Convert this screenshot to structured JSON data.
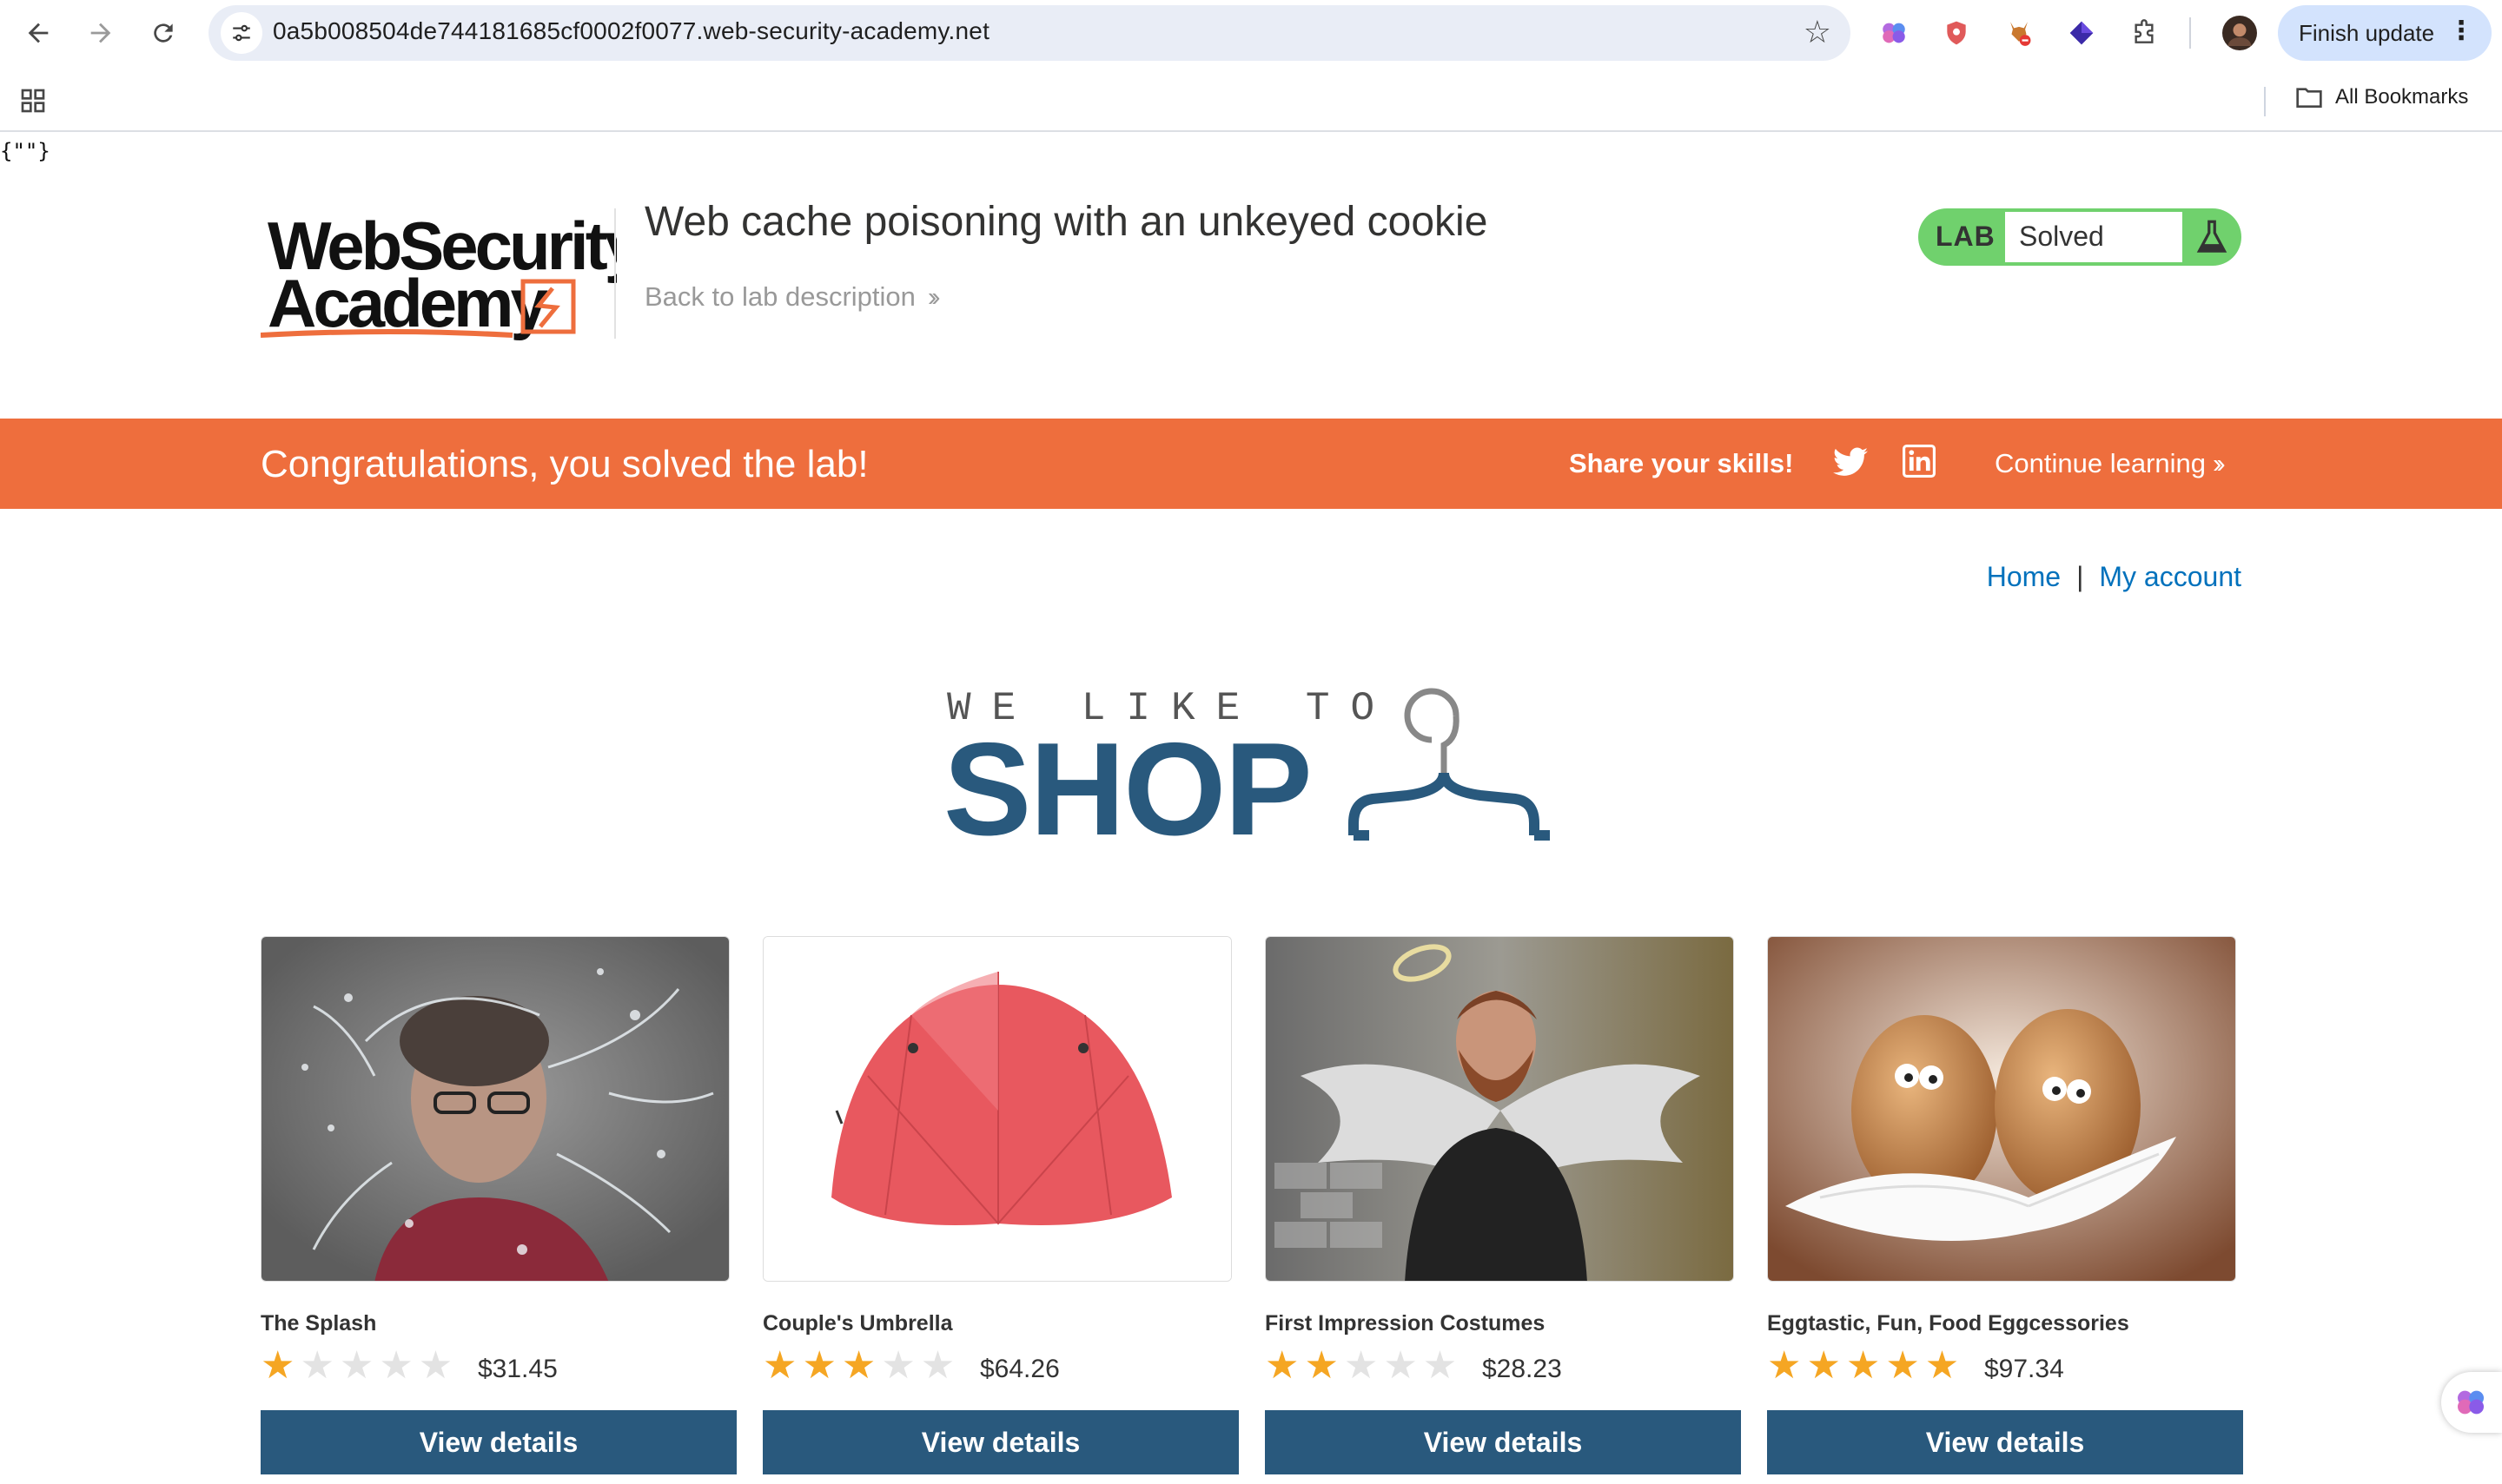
{
  "browser": {
    "url": "0a5b008504de744181685cf0002f0077.web-security-academy.net",
    "finish_update_label": "Finish update",
    "all_bookmarks_label": "All Bookmarks",
    "icons": {
      "back": "arrow-left-icon",
      "forward": "arrow-right-icon",
      "reload": "reload-icon",
      "site_info": "tune-icon",
      "bookmark": "star-icon",
      "apps": "grid-icon",
      "bookmarks_folder": "folder-icon"
    }
  },
  "page": {
    "raw_output": "{\"\"}",
    "header": {
      "logo_line1": "WebSecurity",
      "logo_line2": "Academy",
      "lab_title": "Web cache poisoning with an unkeyed cookie",
      "back_link": "Back to lab description",
      "lab_label": "LAB",
      "lab_status": "Solved"
    },
    "banner": {
      "message": "Congratulations, you solved the lab!",
      "share_label": "Share your skills!",
      "continue_label": "Continue learning"
    },
    "nav": {
      "home": "Home",
      "separator": "|",
      "my_account": "My account"
    },
    "shop_logo": {
      "tagline": "WE LIKE TO",
      "word": "SHOP"
    },
    "products": [
      {
        "name": "The Splash",
        "rating": 1,
        "price": "$31.45",
        "button": "View details"
      },
      {
        "name": "Couple's Umbrella",
        "rating": 3,
        "price": "$64.26",
        "button": "View details"
      },
      {
        "name": "First Impression Costumes",
        "rating": 2,
        "price": "$28.23",
        "button": "View details"
      },
      {
        "name": "Eggtastic, Fun, Food Eggcessories",
        "rating": 5,
        "price": "$97.34",
        "button": "View details"
      }
    ],
    "colors": {
      "banner": "#ee6e3d",
      "primary": "#29597d",
      "link": "#0071bc",
      "lab_solved": "#70d16d",
      "star": "#f5a623"
    }
  }
}
